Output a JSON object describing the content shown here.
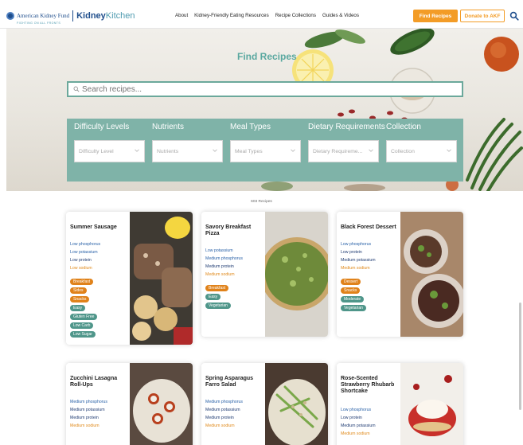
{
  "header": {
    "akf_name": "American Kidney Fund",
    "akf_tagline": "FIGHTING ON ALL FRONTS",
    "site_name_bold": "Kidney",
    "site_name_light": "Kitchen",
    "nav": [
      "About",
      "Kidney-Friendly Eating Resources",
      "Recipe Collections",
      "Guides & Videos"
    ],
    "find_recipes_button": "Find Recipes",
    "donate_button": "Donate to AKF"
  },
  "hero": {
    "title": "Find Recipes",
    "search_placeholder": "Search recipes...",
    "filters": [
      {
        "label": "Difficulty Levels",
        "placeholder": "Difficulty Level"
      },
      {
        "label": "Nutrients",
        "placeholder": "Nutrients"
      },
      {
        "label": "Meal Types",
        "placeholder": "Meal Types"
      },
      {
        "label": "Dietary Requirements",
        "placeholder": "Dietary Requireme..."
      },
      {
        "label": "Collection",
        "placeholder": "Collection"
      }
    ]
  },
  "results": {
    "count_text": "603 Recipes"
  },
  "recipes": [
    {
      "title": "Summer Sausage",
      "nutrients": [
        {
          "text": "Low phosphorus",
          "color": "blue"
        },
        {
          "text": "Low potassium",
          "color": "blue"
        },
        {
          "text": "Low protein",
          "color": "dark"
        },
        {
          "text": "Low sodium",
          "color": "orange"
        }
      ],
      "tags": [
        {
          "text": "Breakfast",
          "color": "orange"
        },
        {
          "text": "Sides",
          "color": "orange"
        },
        {
          "text": "Snacks",
          "color": "orange"
        },
        {
          "text": "Easy",
          "color": "teal"
        },
        {
          "text": "Gluten Free",
          "color": "teal"
        },
        {
          "text": "Low Carb",
          "color": "teal"
        },
        {
          "text": "Low Sugar",
          "color": "teal"
        }
      ]
    },
    {
      "title": "Savory Breakfast Pizza",
      "nutrients": [
        {
          "text": "Low potassium",
          "color": "blue"
        },
        {
          "text": "Medium phosphorus",
          "color": "blue"
        },
        {
          "text": "Medium protein",
          "color": "dark"
        },
        {
          "text": "Medium sodium",
          "color": "orange"
        }
      ],
      "tags": [
        {
          "text": "Breakfast",
          "color": "orange"
        },
        {
          "text": "Easy",
          "color": "teal"
        },
        {
          "text": "Vegetarian",
          "color": "teal"
        }
      ]
    },
    {
      "title": "Black Forest Dessert",
      "nutrients": [
        {
          "text": "Low phosphorus",
          "color": "blue"
        },
        {
          "text": "Low protein",
          "color": "dark"
        },
        {
          "text": "Medium potassium",
          "color": "dark"
        },
        {
          "text": "Medium sodium",
          "color": "orange"
        }
      ],
      "tags": [
        {
          "text": "Dessert",
          "color": "orange"
        },
        {
          "text": "Snacks",
          "color": "orange"
        },
        {
          "text": "Moderate",
          "color": "teal"
        },
        {
          "text": "Vegetarian",
          "color": "teal"
        }
      ]
    },
    {
      "title": "Zucchini Lasagna Roll-Ups",
      "nutrients": [
        {
          "text": "Medium phosphorus",
          "color": "blue"
        },
        {
          "text": "Medium potassium",
          "color": "dark"
        },
        {
          "text": "Medium protein",
          "color": "dark"
        },
        {
          "text": "Medium sodium",
          "color": "orange"
        }
      ],
      "tags": []
    },
    {
      "title": "Spring Asparagus Farro Salad",
      "nutrients": [
        {
          "text": "Medium phosphorus",
          "color": "blue"
        },
        {
          "text": "Medium potassium",
          "color": "dark"
        },
        {
          "text": "Medium protein",
          "color": "dark"
        },
        {
          "text": "Medium sodium",
          "color": "orange"
        }
      ],
      "tags": []
    },
    {
      "title": "Rose-Scented Strawberry Rhubarb Shortcake",
      "nutrients": [
        {
          "text": "Low phosphorus",
          "color": "blue"
        },
        {
          "text": "Low protein",
          "color": "dark"
        },
        {
          "text": "Medium potassium",
          "color": "dark"
        },
        {
          "text": "Medium sodium",
          "color": "orange"
        }
      ],
      "tags": []
    }
  ],
  "colors": {
    "accent_orange": "#f39c27",
    "teal_panel": "#7fb3a8",
    "brand_blue": "#1f4e8c"
  }
}
